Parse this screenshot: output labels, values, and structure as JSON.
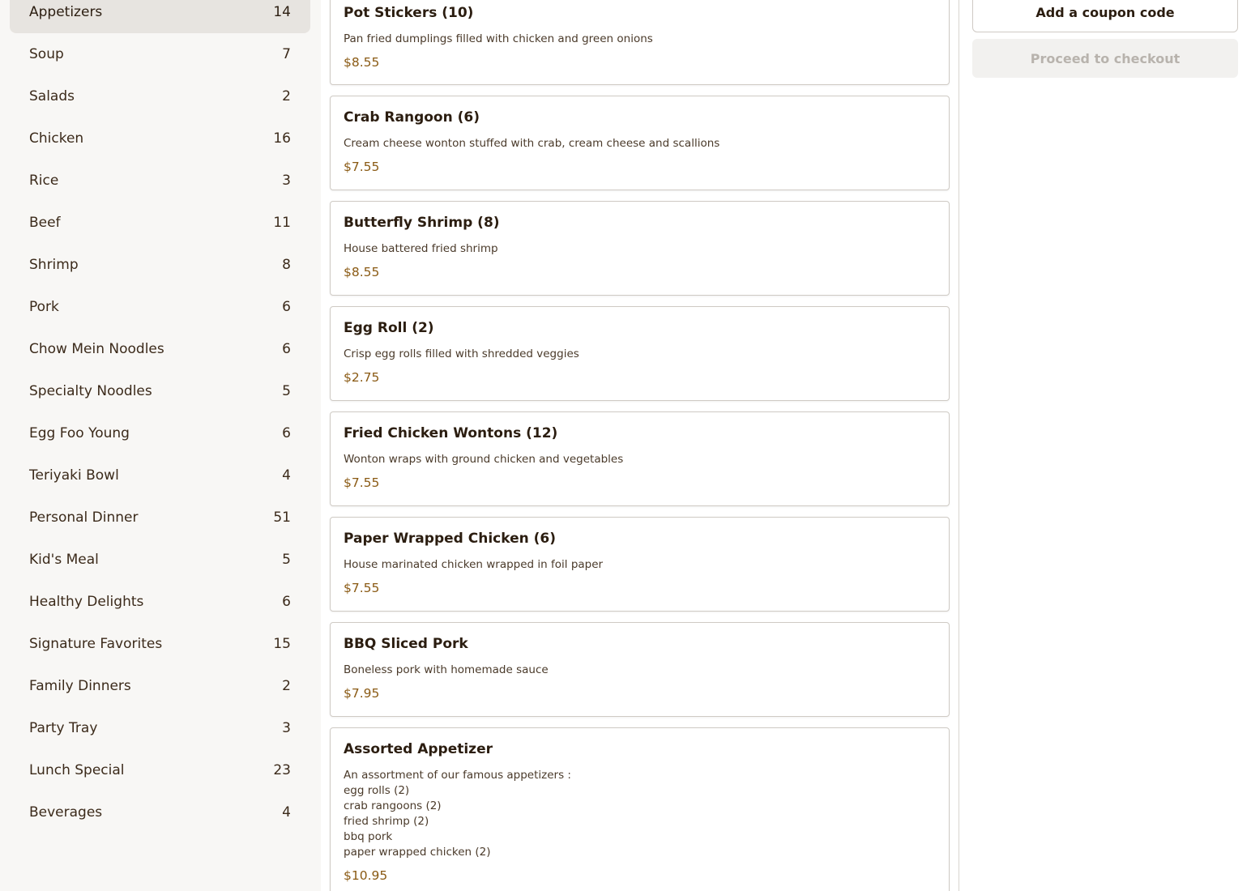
{
  "categories": [
    {
      "label": "Appetizers",
      "count": "14",
      "active": true
    },
    {
      "label": "Soup",
      "count": "7"
    },
    {
      "label": "Salads",
      "count": "2"
    },
    {
      "label": "Chicken",
      "count": "16"
    },
    {
      "label": "Rice",
      "count": "3"
    },
    {
      "label": "Beef",
      "count": "11"
    },
    {
      "label": "Shrimp",
      "count": "8"
    },
    {
      "label": "Pork",
      "count": "6"
    },
    {
      "label": "Chow Mein Noodles",
      "count": "6"
    },
    {
      "label": "Specialty Noodles",
      "count": "5"
    },
    {
      "label": "Egg Foo Young",
      "count": "6"
    },
    {
      "label": "Teriyaki Bowl",
      "count": "4"
    },
    {
      "label": "Personal Dinner",
      "count": "51"
    },
    {
      "label": "Kid's Meal",
      "count": "5"
    },
    {
      "label": "Healthy Delights",
      "count": "6"
    },
    {
      "label": "Signature Favorites",
      "count": "15"
    },
    {
      "label": "Family Dinners",
      "count": "2"
    },
    {
      "label": "Party Tray",
      "count": "3"
    },
    {
      "label": "Lunch Special",
      "count": "23"
    },
    {
      "label": "Beverages",
      "count": "4"
    }
  ],
  "items": [
    {
      "name": "Pot Stickers (10)",
      "description": "Pan fried dumplings filled with chicken and green onions",
      "price": "$8.55"
    },
    {
      "name": "Crab Rangoon (6)",
      "description": "Cream cheese wonton stuffed with crab, cream cheese and scallions",
      "price": "$7.55"
    },
    {
      "name": "Butterfly Shrimp (8)",
      "description": "House battered fried shrimp",
      "price": "$8.55"
    },
    {
      "name": "Egg Roll (2)",
      "description": "Crisp egg rolls filled with shredded veggies",
      "price": "$2.75"
    },
    {
      "name": "Fried Chicken Wontons (12)",
      "description": "Wonton wraps with ground chicken and vegetables",
      "price": "$7.55"
    },
    {
      "name": "Paper Wrapped Chicken (6)",
      "description": "House marinated chicken wrapped in foil paper",
      "price": "$7.55"
    },
    {
      "name": "BBQ Sliced Pork",
      "description": "Boneless pork with homemade sauce",
      "price": "$7.95"
    },
    {
      "name": "Assorted Appetizer",
      "description": "An assortment of our famous appetizers :\negg rolls (2)\ncrab rangoons (2)\nfried shrimp (2)\nbbq pork\npaper wrapped chicken (2)",
      "price": "$10.95"
    }
  ],
  "cart": {
    "coupon_label": "Add a coupon code",
    "checkout_label": "Proceed to checkout"
  }
}
